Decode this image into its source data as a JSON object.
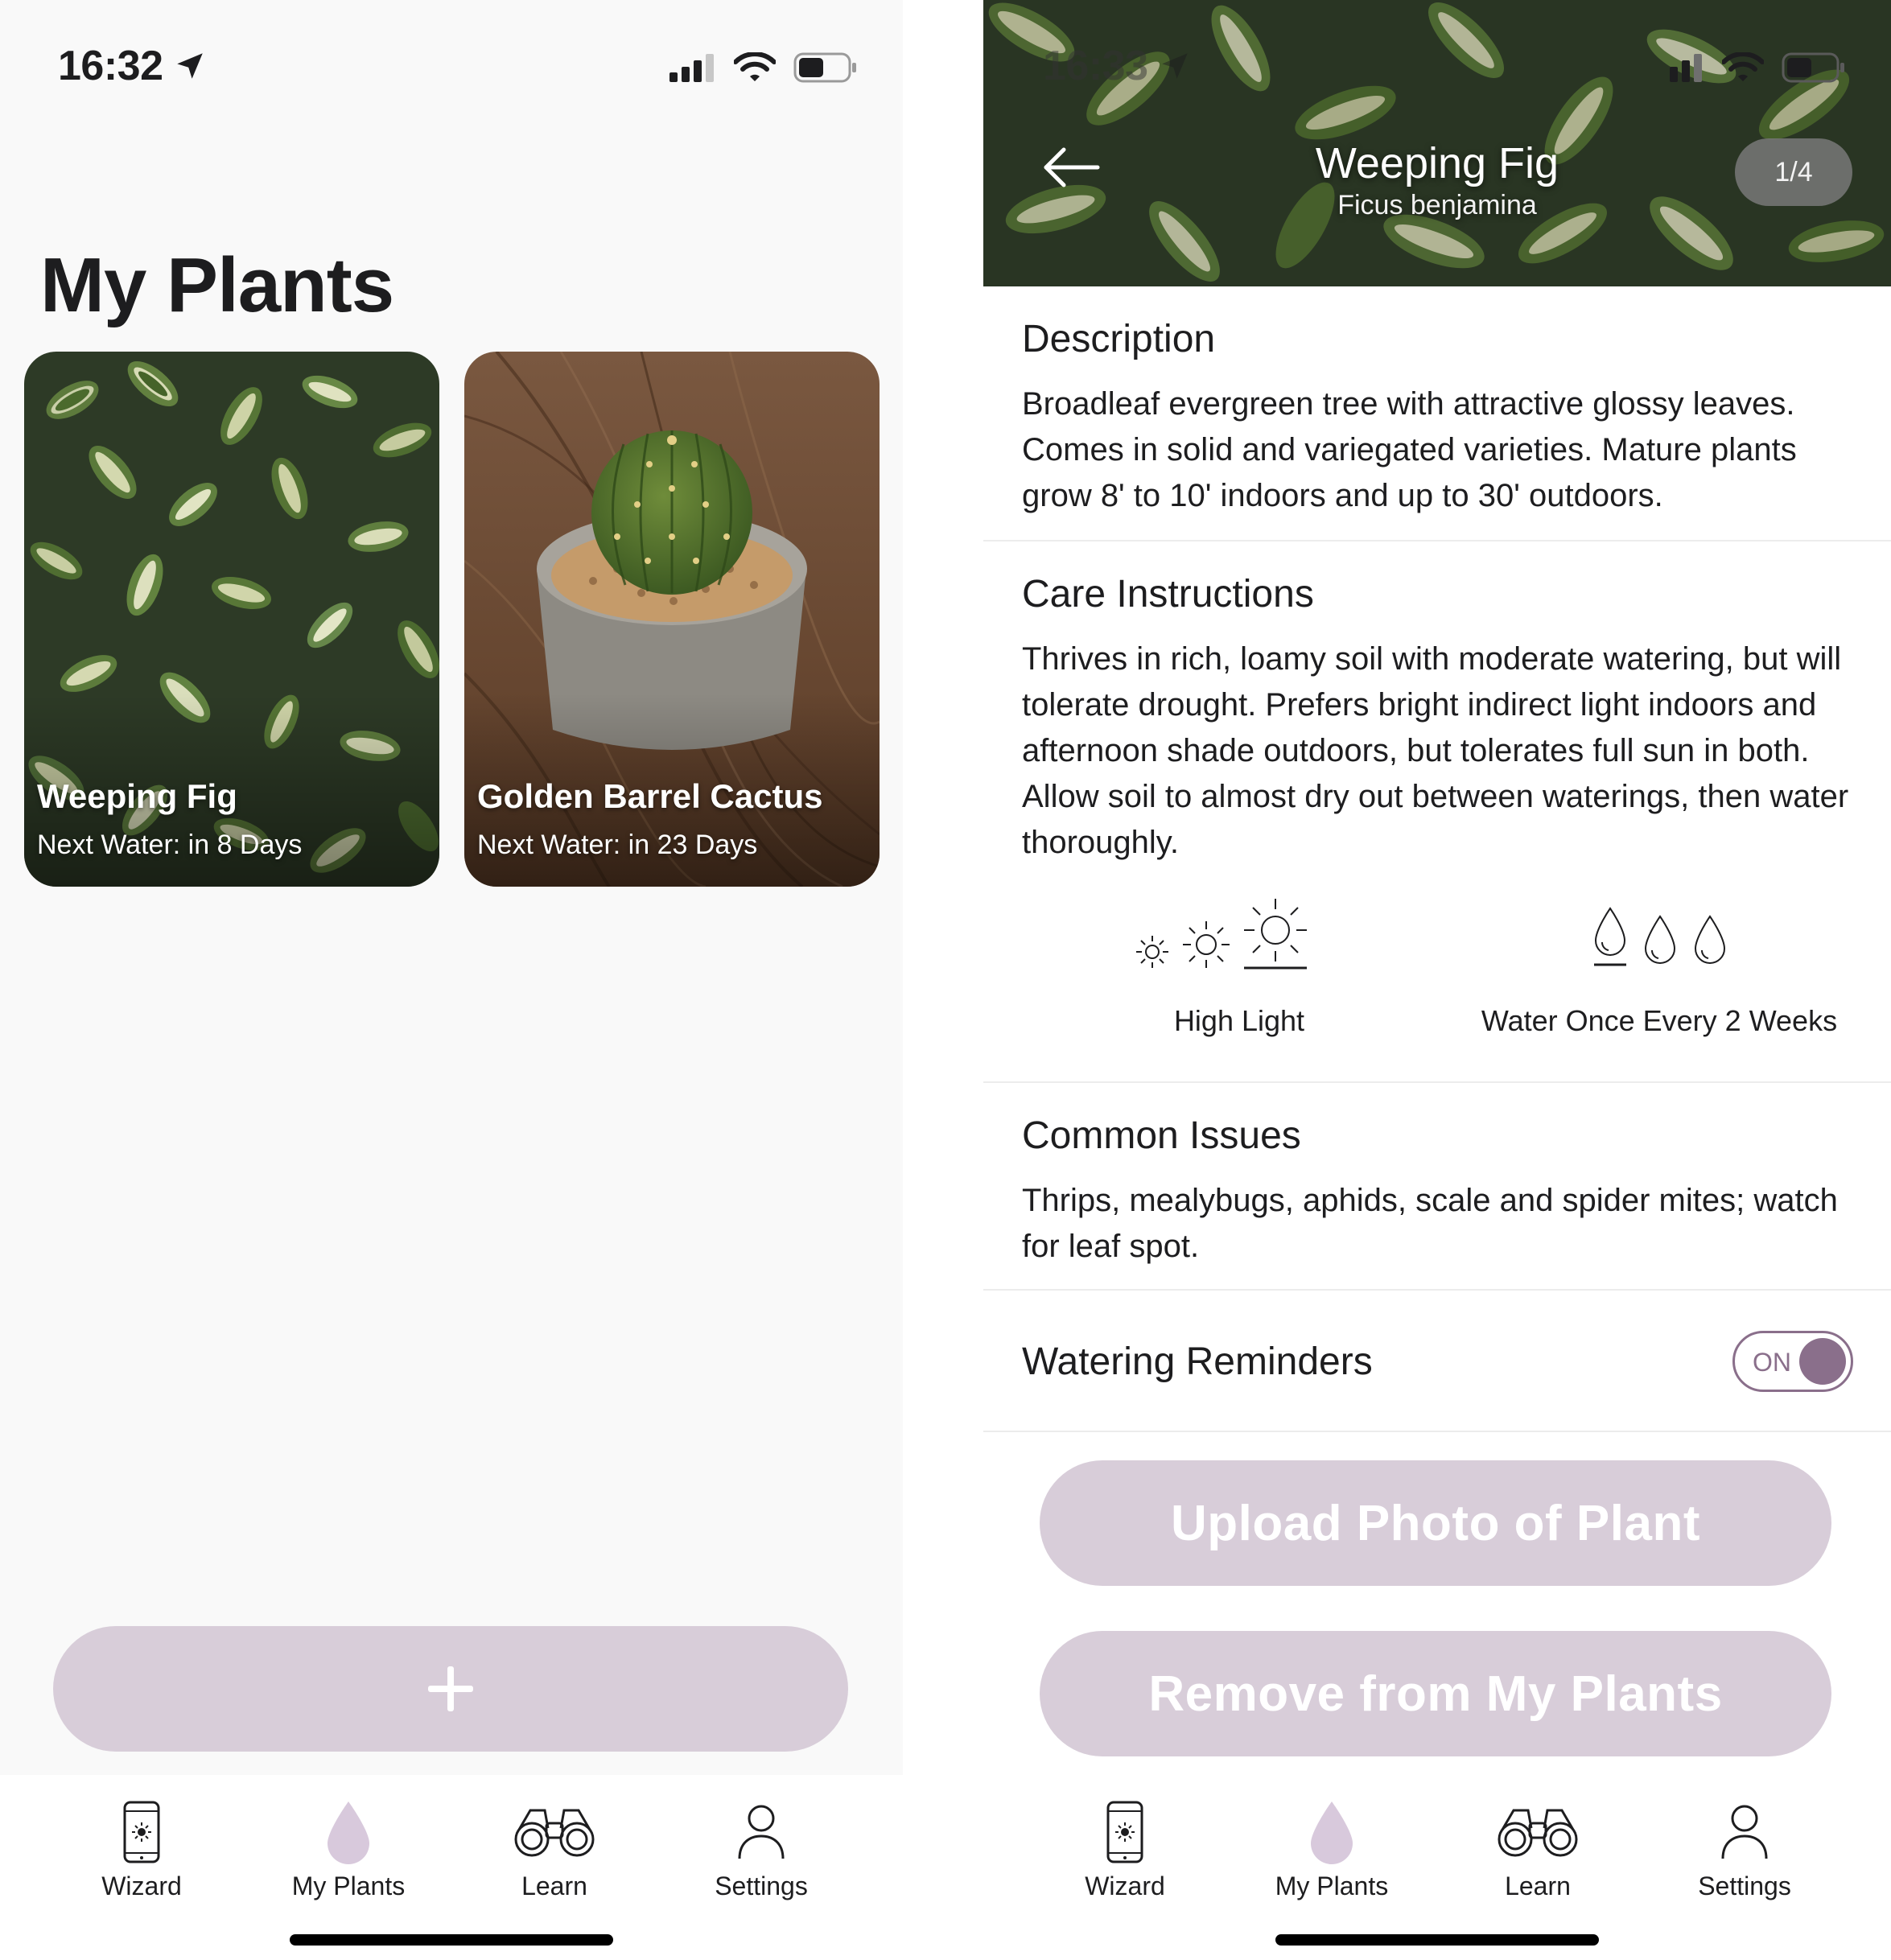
{
  "colors": {
    "accent": "#8a6f8b",
    "button_fill": "#d8cdd9",
    "background_left": "#f9f9f9",
    "tab_drop": "#d8c9dc"
  },
  "left_screen": {
    "status_bar": {
      "time": "16:32"
    },
    "page_title": "My Plants",
    "cards": [
      {
        "name": "Weeping Fig",
        "next_water": "Next Water: in 8 Days",
        "image_icon": "ficus-leaves-image"
      },
      {
        "name": "Golden Barrel Cactus",
        "next_water": "Next Water: in 23 Days",
        "image_icon": "potted-cactus-image"
      }
    ],
    "add_button": {
      "label": "+"
    }
  },
  "right_screen": {
    "status_bar": {
      "time": "16:33"
    },
    "header": {
      "title": "Weeping Fig",
      "subtitle": "Ficus benjamina",
      "photo_counter": "1/4"
    },
    "description": {
      "heading": "Description",
      "body": "Broadleaf evergreen tree with attractive glossy leaves. Comes in solid and variegated varieties. Mature plants grow 8' to 10' indoors and up to 30' outdoors."
    },
    "care": {
      "heading": "Care Instructions",
      "body": "Thrives in rich, loamy soil with moderate watering, but will tolerate drought. Prefers bright indirect light indoors and afternoon shade outdoors, but tolerates full sun in both. Allow soil to almost dry out between waterings, then water thoroughly.",
      "light_label": "High Light",
      "light_level": 3,
      "water_label": "Water Once Every 2 Weeks",
      "water_level": 1
    },
    "issues": {
      "heading": "Common Issues",
      "body": "Thrips, mealybugs, aphids, scale and spider mites; watch for leaf spot."
    },
    "reminders": {
      "label": "Watering Reminders",
      "toggle_text": "ON",
      "enabled": true
    },
    "buttons": {
      "upload": "Upload Photo of Plant",
      "remove": "Remove from My Plants"
    }
  },
  "tab_bar": {
    "items": [
      {
        "label": "Wizard",
        "icon": "phone-sun-icon"
      },
      {
        "label": "My Plants",
        "icon": "water-drop-icon",
        "selected": true
      },
      {
        "label": "Learn",
        "icon": "binoculars-icon"
      },
      {
        "label": "Settings",
        "icon": "person-icon"
      }
    ]
  }
}
